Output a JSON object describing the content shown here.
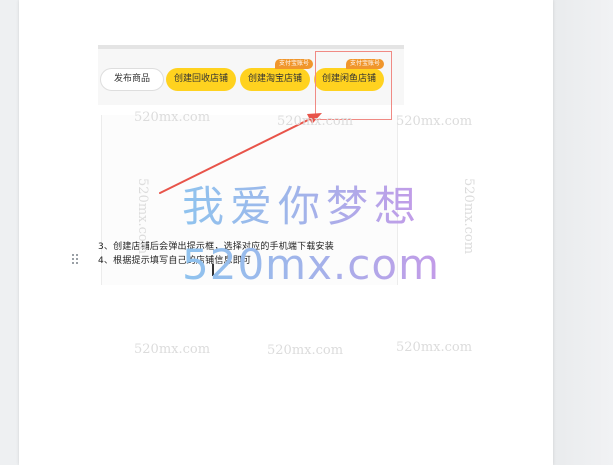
{
  "document": {
    "screenshot_buttons": {
      "publish": "发布商品",
      "create_recycle": "创建回收店铺",
      "create_taobao": "创建淘宝店铺",
      "create_xianyu": "创建闲鱼店铺"
    },
    "screenshot_badges": {
      "taobao_badge": "支付宝账号",
      "xianyu_badge": "支付宝账号"
    },
    "list": {
      "item3": "3、创建店铺后会弹出提示框，选择对应的手机端下载安装",
      "item4": "4、根据提示填写自己的店铺信息即可"
    }
  },
  "watermark": {
    "chinese": "我爱你梦想",
    "domain": "520mx.com",
    "repeat_text": "520mx.com"
  },
  "colors": {
    "accent_yellow": "#ffd21f",
    "badge_orange": "#f0962c",
    "annotation_red": "#e8544a",
    "watermark_gradient_start": "#8fc3ee",
    "watermark_gradient_end": "#c39be8"
  }
}
